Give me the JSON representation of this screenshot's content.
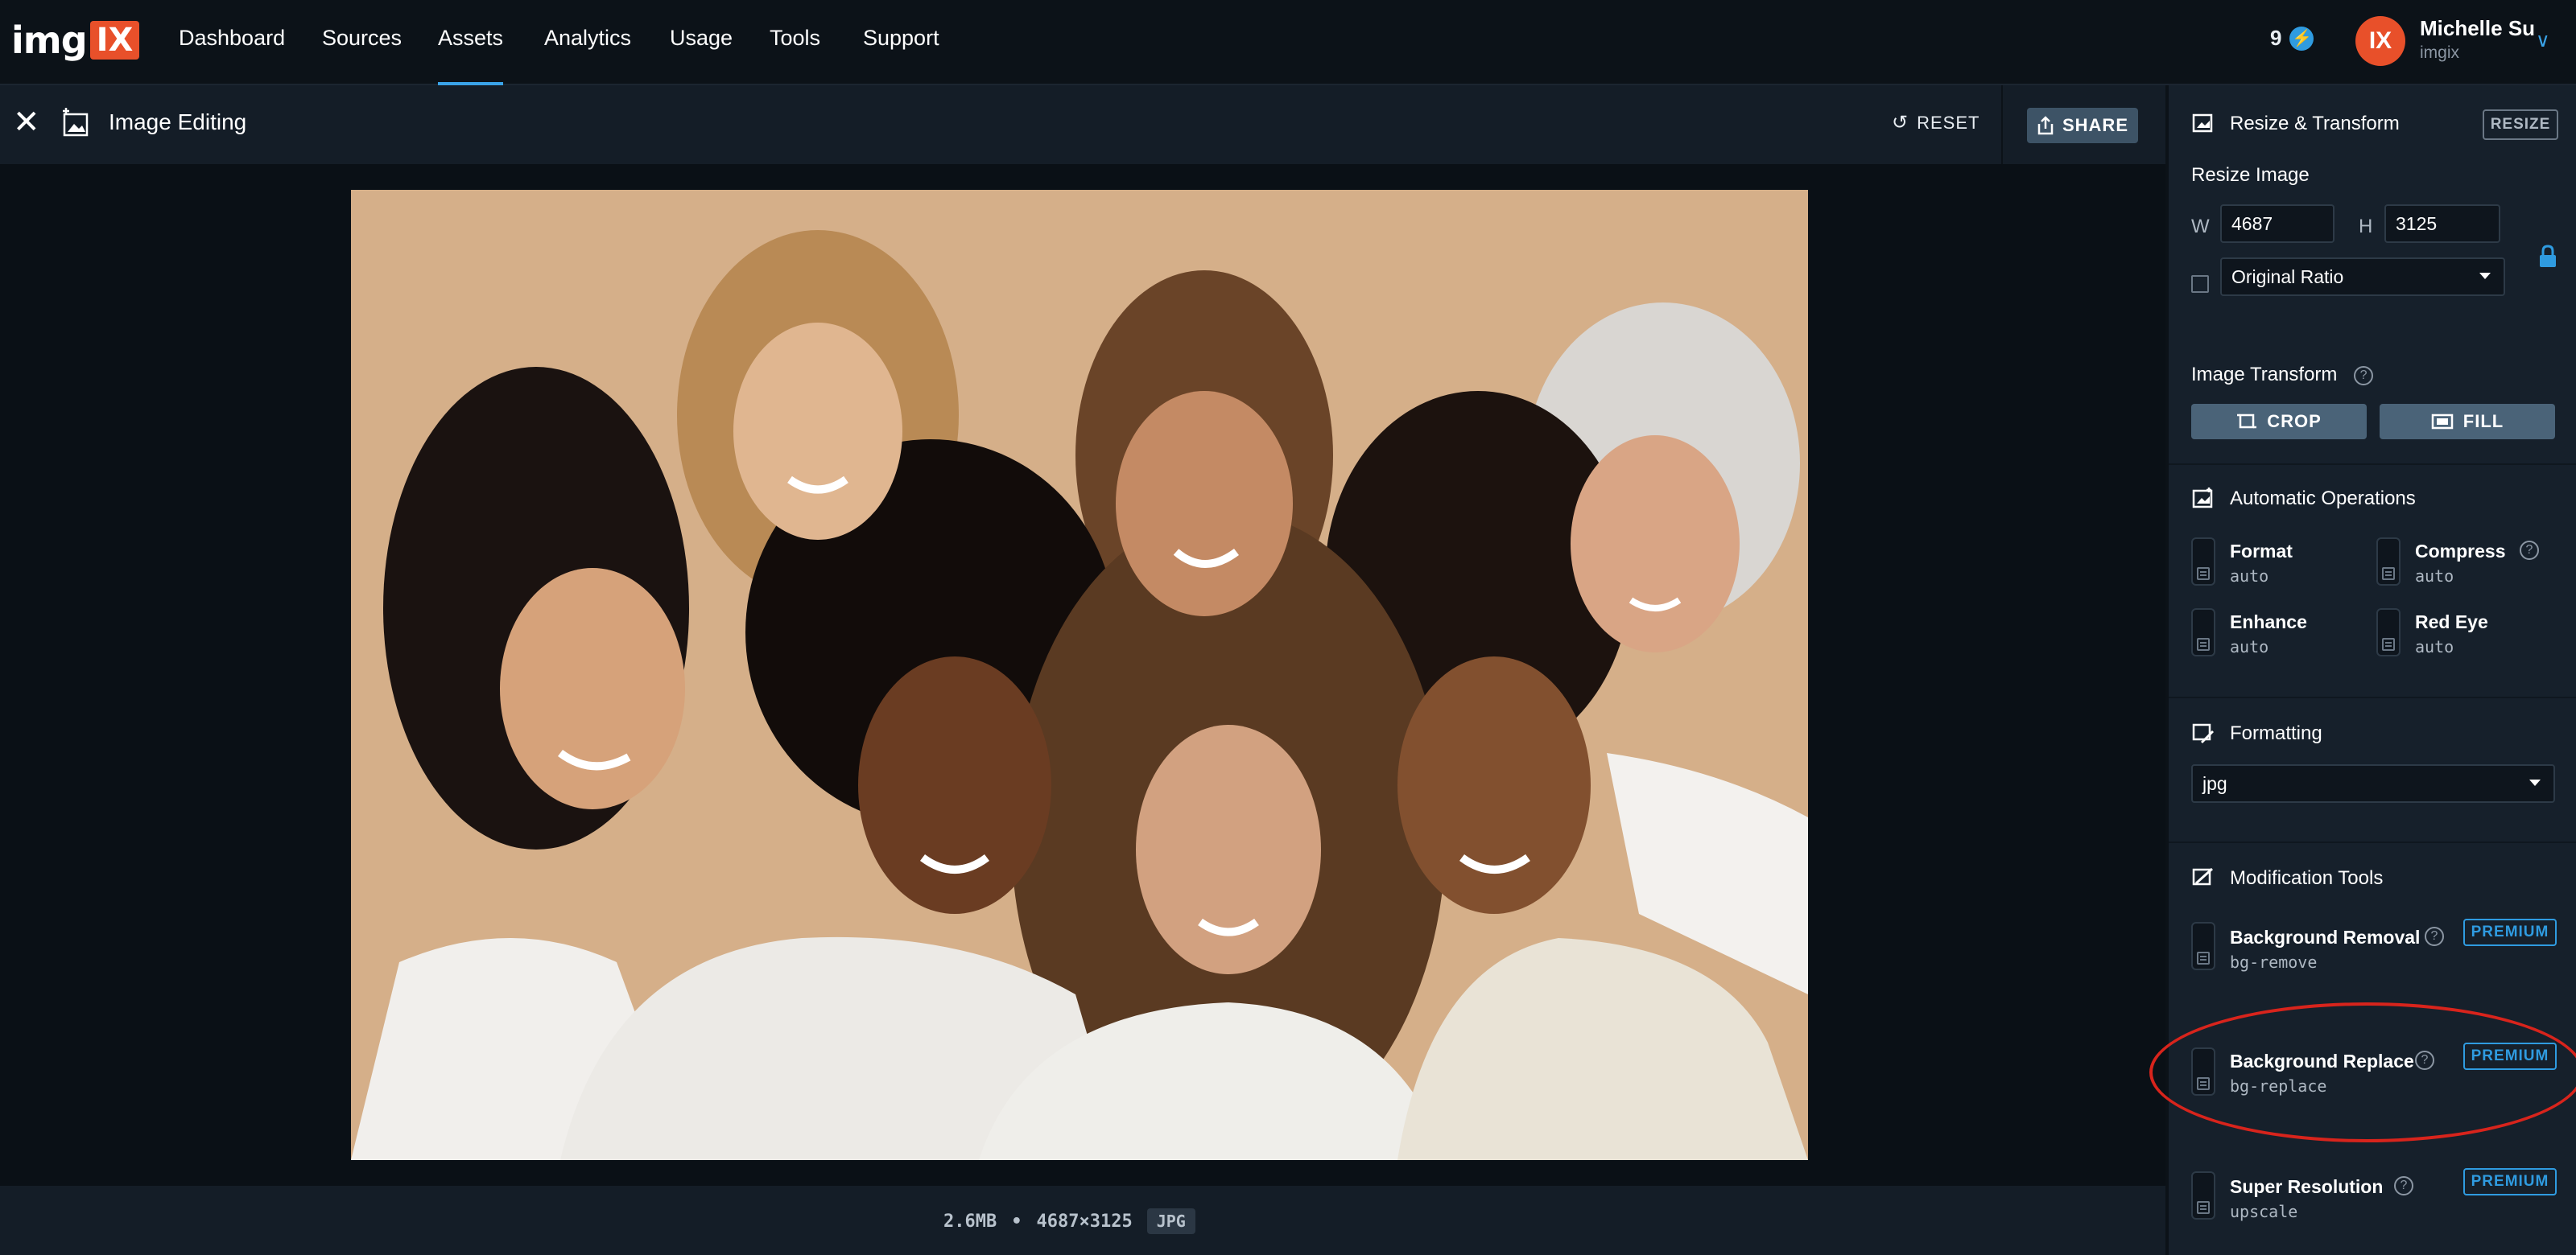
{
  "brand": {
    "logo_text": "img",
    "logo_badge": "IX"
  },
  "nav": {
    "items": [
      {
        "label": "Dashboard"
      },
      {
        "label": "Sources"
      },
      {
        "label": "Assets"
      },
      {
        "label": "Analytics"
      },
      {
        "label": "Usage"
      },
      {
        "label": "Tools"
      },
      {
        "label": "Support"
      }
    ],
    "active": "Assets"
  },
  "user": {
    "notifications": "9",
    "avatar_initials": "IX",
    "name": "Michelle Su",
    "org": "imgix"
  },
  "editor": {
    "title": "Image Editing",
    "reset_label": "RESET",
    "share_label": "SHARE"
  },
  "image_meta": {
    "size": "2.6MB",
    "separator": "•",
    "dimensions": "4687×3125",
    "format": "JPG"
  },
  "panel": {
    "resize": {
      "title": "Resize & Transform",
      "badge": "RESIZE",
      "subtitle": "Resize Image",
      "w_label": "W",
      "w_value": "4687",
      "h_label": "H",
      "h_value": "3125",
      "ratio_value": "Original Ratio"
    },
    "transform": {
      "title": "Image Transform",
      "crop_label": "CROP",
      "fill_label": "FILL"
    },
    "auto_ops": {
      "title": "Automatic Operations",
      "items": [
        {
          "name": "Format",
          "value": "auto"
        },
        {
          "name": "Compress",
          "value": "auto"
        },
        {
          "name": "Enhance",
          "value": "auto"
        },
        {
          "name": "Red Eye",
          "value": "auto"
        }
      ]
    },
    "formatting": {
      "title": "Formatting",
      "value": "jpg"
    },
    "modification": {
      "title": "Modification Tools",
      "tools": [
        {
          "name": "Background Removal",
          "param": "bg-remove",
          "badge": "PREMIUM"
        },
        {
          "name": "Background Replace",
          "param": "bg-replace",
          "badge": "PREMIUM"
        },
        {
          "name": "Super Resolution",
          "param": "upscale",
          "badge": "PREMIUM"
        }
      ]
    }
  },
  "colors": {
    "accent": "#2f9be0",
    "brand": "#e8502a",
    "highlight": "#d8241c"
  }
}
